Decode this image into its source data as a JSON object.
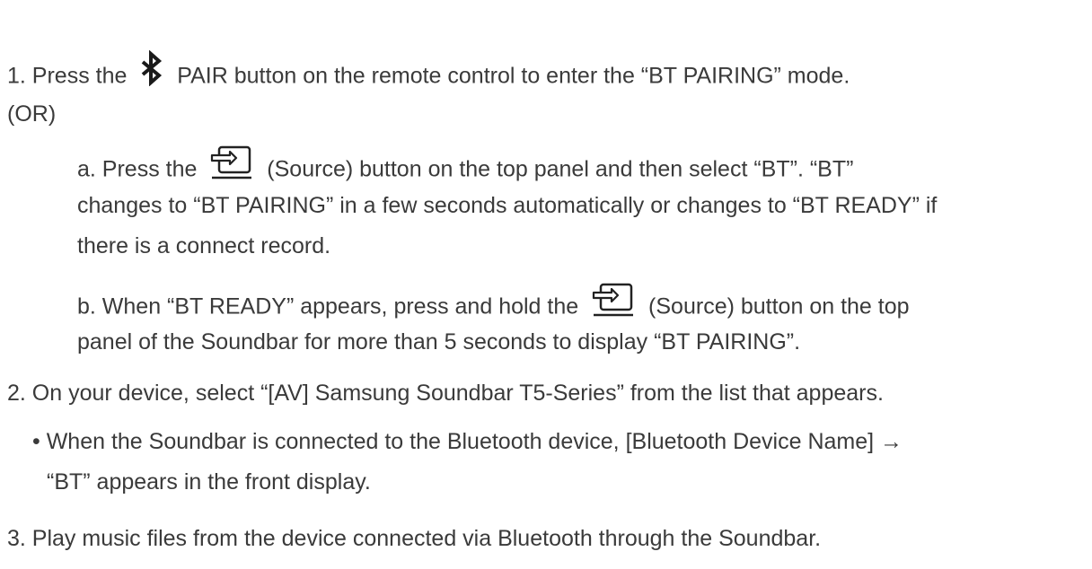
{
  "step1": {
    "before": "1. Press the ",
    "icon": "bluetooth-icon",
    "after": " PAIR button on the remote control to enter the “BT PAIRING” mode."
  },
  "or_label": "(OR)",
  "sub_a": {
    "before": "a. Press the ",
    "icon": "source-icon",
    "after": " (Source) button on the top panel and then select “BT”. “BT”",
    "line2": "changes to “BT PAIRING” in a few seconds automatically or changes to “BT READY” if",
    "line3": "there is a connect record."
  },
  "sub_b": {
    "before": "b. When “BT READY” appears, press and hold the ",
    "icon": "source-icon",
    "after": " (Source) button on the top",
    "line2": "panel of the Soundbar for more than 5 seconds to display “BT PAIRING”."
  },
  "step2": "2. On your device, select “[AV] Samsung Soundbar T5-Series” from the list that appears.",
  "bullet": {
    "line1": "• When the Soundbar is connected to the Bluetooth device, [Bluetooth Device Name] →",
    "line2": "“BT” appears in the front display."
  },
  "step3": "3. Play music files from the device connected via Bluetooth through the Soundbar."
}
